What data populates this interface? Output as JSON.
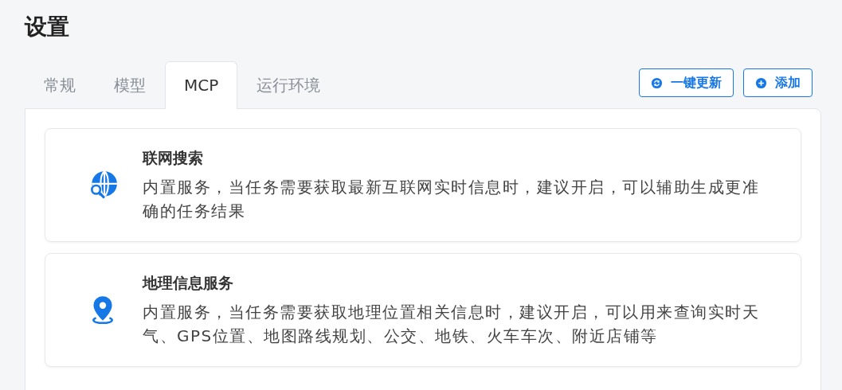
{
  "page": {
    "title": "设置"
  },
  "tabs": [
    {
      "label": "常规",
      "selected": false
    },
    {
      "label": "模型",
      "selected": false
    },
    {
      "label": "MCP",
      "selected": true
    },
    {
      "label": "运行环境",
      "selected": false
    }
  ],
  "actions": [
    {
      "kind": "refresh",
      "label": "一键更新"
    },
    {
      "kind": "add",
      "label": "添加"
    }
  ],
  "services": [
    {
      "kind": "globe-search",
      "title": "联网搜索",
      "description": "内置服务，当任务需要获取最新互联网实时信息时，建议开启，可以辅助生成更准确的任务结果"
    },
    {
      "kind": "location",
      "title": "地理信息服务",
      "description": "内置服务，当任务需要获取地理位置相关信息时，建议开启，可以用来查询实时天气、GPS位置、地图路线规划、公交、地铁、火车车次、附近店铺等"
    }
  ]
}
